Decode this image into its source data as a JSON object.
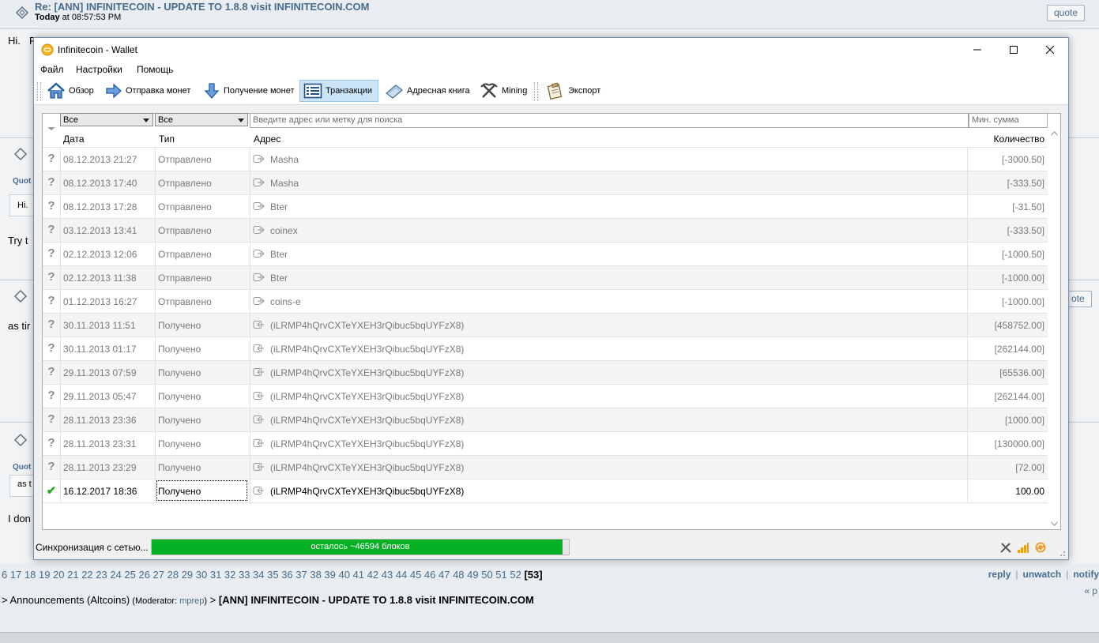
{
  "forum": {
    "post_title": "Re: [ANN] INFINITECOIN - UPDATE TO 1.8.8 visit INFINITECOIN.COM",
    "post_date_label": "Today",
    "post_date_time": " at 08:57:53 PM",
    "quote_label": "quote",
    "quote_label_partial": "ote",
    "fragments": {
      "hi": "Hi.",
      "hi_partial": "R",
      "quot1": "Quot",
      "hi2": "Hi.",
      "try": "Try t",
      "astime": "as tir",
      "quot2": "Quot",
      "ast": "as t",
      "idon": "I don"
    },
    "pages_prefix": "6 17 18 19 20 21 22 23 24 25 26 27 28 29 30 31 32 33 34 35 36 37 38 39 40 41 42 43 44 45 46 47 48 49 50 51 52",
    "current_page": "[53]",
    "links": {
      "reply": "reply",
      "unwatch": "unwatch",
      "notify": "notify"
    },
    "prev_link": "« p",
    "breadcrumb": {
      "board": "> Announcements (Altcoins)",
      "mod_open": " (Moderator: ",
      "moderator": "mprep",
      "mod_close": ")",
      "arrow": " > ",
      "thread": "[ANN] INFINITECOIN - UPDATE TO 1.8.8 visit INFINITECOIN.COM"
    }
  },
  "window": {
    "title": "Infinitecoin - Wallet",
    "menu": [
      "Файл",
      "Настройки",
      "Помощь"
    ],
    "toolbar": {
      "overview": "Обзор",
      "send": "Отправка монет",
      "receive": "Получение монет",
      "transactions": "Транзакции",
      "addressbook": "Адресная книга",
      "mining": "Mining",
      "export": "Экспорт"
    },
    "filters": {
      "date_filter": "Все",
      "type_filter": "Все",
      "search_placeholder": "Введите адрес или метку для поиска",
      "min_amount_placeholder": "Мин. сумма"
    },
    "columns": {
      "date": "Дата",
      "type": "Тип",
      "address": "Адрес",
      "amount": "Количество"
    },
    "transactions": [
      {
        "date": "08.12.2013 21:27",
        "type": "Отправлено",
        "dir": "out",
        "address": "Masha",
        "amount": "[-3000.50]",
        "confirmed": false
      },
      {
        "date": "08.12.2013 17:40",
        "type": "Отправлено",
        "dir": "out",
        "address": "Masha",
        "amount": "[-333.50]",
        "confirmed": false
      },
      {
        "date": "08.12.2013 17:28",
        "type": "Отправлено",
        "dir": "out",
        "address": "Bter",
        "amount": "[-31.50]",
        "confirmed": false
      },
      {
        "date": "03.12.2013 13:41",
        "type": "Отправлено",
        "dir": "out",
        "address": "coinex",
        "amount": "[-333.50]",
        "confirmed": false
      },
      {
        "date": "02.12.2013 12:06",
        "type": "Отправлено",
        "dir": "out",
        "address": "Bter",
        "amount": "[-1000.50]",
        "confirmed": false
      },
      {
        "date": "02.12.2013 11:38",
        "type": "Отправлено",
        "dir": "out",
        "address": "Bter",
        "amount": "[-1000.00]",
        "confirmed": false
      },
      {
        "date": "01.12.2013 16:27",
        "type": "Отправлено",
        "dir": "out",
        "address": "coins-e",
        "amount": "[-1000.00]",
        "confirmed": false
      },
      {
        "date": "30.11.2013 11:51",
        "type": "Получено",
        "dir": "in",
        "address": "(iLRMP4hQrvCXTeYXEH3rQibuc5bqUYFzX8)",
        "amount": "[458752.00]",
        "confirmed": false
      },
      {
        "date": "30.11.2013 01:17",
        "type": "Получено",
        "dir": "in",
        "address": "(iLRMP4hQrvCXTeYXEH3rQibuc5bqUYFzX8)",
        "amount": "[262144.00]",
        "confirmed": false
      },
      {
        "date": "29.11.2013 07:59",
        "type": "Получено",
        "dir": "in",
        "address": "(iLRMP4hQrvCXTeYXEH3rQibuc5bqUYFzX8)",
        "amount": "[65536.00]",
        "confirmed": false
      },
      {
        "date": "29.11.2013 05:47",
        "type": "Получено",
        "dir": "in",
        "address": "(iLRMP4hQrvCXTeYXEH3rQibuc5bqUYFzX8)",
        "amount": "[262144.00]",
        "confirmed": false
      },
      {
        "date": "28.11.2013 23:36",
        "type": "Получено",
        "dir": "in",
        "address": "(iLRMP4hQrvCXTeYXEH3rQibuc5bqUYFzX8)",
        "amount": "[1000.00]",
        "confirmed": false
      },
      {
        "date": "28.11.2013 23:31",
        "type": "Получено",
        "dir": "in",
        "address": "(iLRMP4hQrvCXTeYXEH3rQibuc5bqUYFzX8)",
        "amount": "[130000.00]",
        "confirmed": false
      },
      {
        "date": "28.11.2013 23:29",
        "type": "Получено",
        "dir": "in",
        "address": "(iLRMP4hQrvCXTeYXEH3rQibuc5bqUYFzX8)",
        "amount": "[72.00]",
        "confirmed": false
      },
      {
        "date": "16.12.2017 18:36",
        "type": "Получено",
        "dir": "in",
        "address": "(iLRMP4hQrvCXTeYXEH3rQibuc5bqUYFzX8)",
        "amount": "100.00",
        "confirmed": true
      }
    ],
    "status": {
      "sync_label": "Синхронизация с сетью...",
      "progress_text": "осталось ~46594 блоков",
      "progress_fraction": 0.985
    },
    "colors": {
      "progress": "#06b025",
      "active_tab": "#cce4f7",
      "confirmed": "#29a824"
    }
  }
}
